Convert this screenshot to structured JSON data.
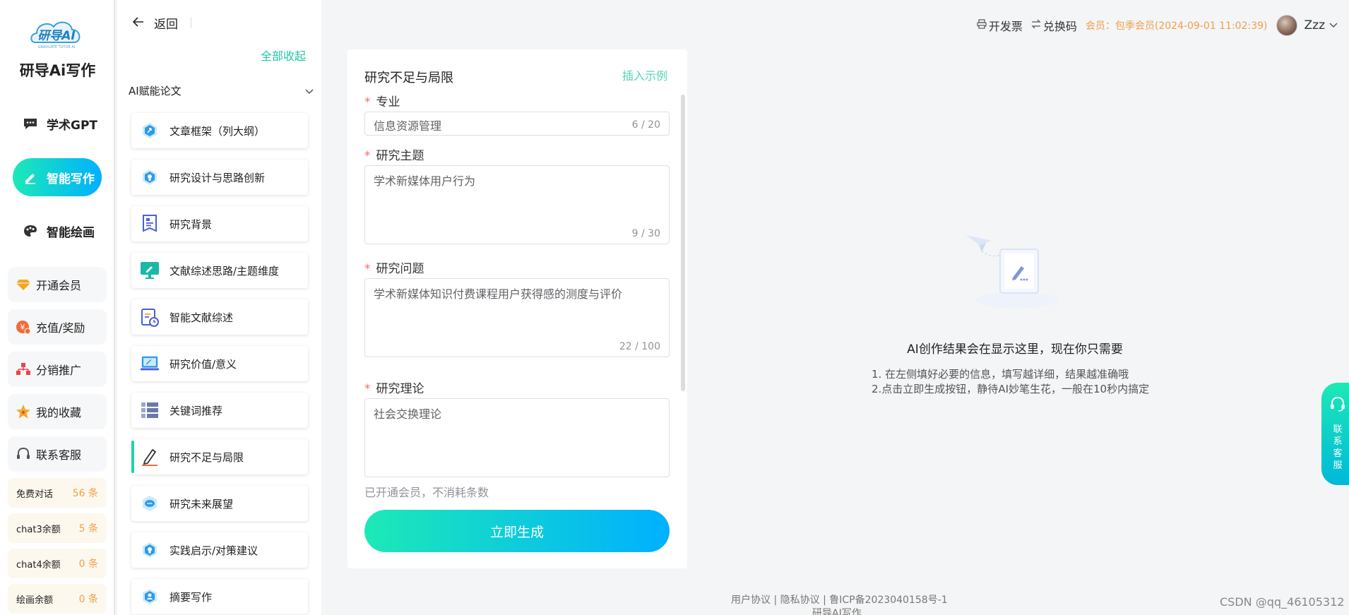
{
  "brand": {
    "name": "研导Ai写作",
    "logo_text": "研导AI",
    "logo_sub": "GRADUATE TUTOR AI"
  },
  "nav": [
    {
      "label": "学术GPT",
      "icon": "chat-icon"
    },
    {
      "label": "智能写作",
      "icon": "pen-icon",
      "active": true
    },
    {
      "label": "智能绘画",
      "icon": "palette-icon"
    }
  ],
  "menu": [
    {
      "label": "开通会员",
      "icon": "diamond-icon"
    },
    {
      "label": "充值/奖励",
      "icon": "coin-icon"
    },
    {
      "label": "分销推广",
      "icon": "share-icon"
    },
    {
      "label": "我的收藏",
      "icon": "star-icon"
    },
    {
      "label": "联系客服",
      "icon": "headset-icon"
    }
  ],
  "quotas": [
    {
      "label": "免费对话",
      "value": "56 条"
    },
    {
      "label": "chat3余额",
      "value": "5 条"
    },
    {
      "label": "chat4余额",
      "value": "0 条"
    },
    {
      "label": "绘画余额",
      "value": "0 条"
    }
  ],
  "sidebar2": {
    "back_label": "返回",
    "collapse_all": "全部收起",
    "section_title": "AI赋能论文",
    "items": [
      {
        "label": "文章框架（列大纲）",
        "icon": "outline-icon"
      },
      {
        "label": "研究设计与思路创新",
        "icon": "design-icon"
      },
      {
        "label": "研究背景",
        "icon": "document-icon"
      },
      {
        "label": "文献综述思路/主题维度",
        "icon": "monitor-pen-icon"
      },
      {
        "label": "智能文献综述",
        "icon": "calendar-clock-icon"
      },
      {
        "label": "研究价值/意义",
        "icon": "laptop-icon"
      },
      {
        "label": "关键词推荐",
        "icon": "list-icon"
      },
      {
        "label": "研究不足与局限",
        "icon": "pencil-icon",
        "active": true
      },
      {
        "label": "研究未来展望",
        "icon": "chat-bubble-icon"
      },
      {
        "label": "实践启示/对策建议",
        "icon": "lightbulb-icon"
      },
      {
        "label": "摘要写作",
        "icon": "user-icon"
      }
    ]
  },
  "form": {
    "title": "研究不足与局限",
    "insert_example": "插入示例",
    "fields": [
      {
        "label": "专业",
        "value": "信息资源管理",
        "count": "6 / 20"
      },
      {
        "label": "研究主题",
        "value": "学术新媒体用户行为",
        "count": "9 / 30"
      },
      {
        "label": "研究问题",
        "value": "学术新媒体知识付费课程用户获得感的测度与评价",
        "count": "22 / 100"
      },
      {
        "label": "研究理论",
        "value": "社会交换理论",
        "count": ""
      }
    ],
    "member_note": "已开通会员，不消耗条数",
    "generate_label": "立即生成"
  },
  "header": {
    "invoice_label": "开发票",
    "redeem_label": "兑换码",
    "member_info": "会员：包季会员(2024-09-01 11:02:39)",
    "username": "Zzz"
  },
  "result": {
    "title": "AI创作结果会在显示这里，现在你只需要",
    "tip1": "1. 在左侧填好必要的信息，填写越详细，结果越准确哦",
    "tip2": "2.点击立即生成按钮，静待AI妙笔生花，一般在10秒内搞定"
  },
  "float_service": {
    "label": "联系客服"
  },
  "footer": {
    "links": "用户协议 | 隐私协议 | 鲁ICP备2023040158号-1",
    "name": "研导AI写作"
  },
  "watermark": "CSDN @qq_46105312",
  "colors": {
    "accent_start": "#1de9b6",
    "accent_end": "#00b0ff",
    "member_orange": "#f0a04b",
    "required_red": "#f56c6c"
  }
}
